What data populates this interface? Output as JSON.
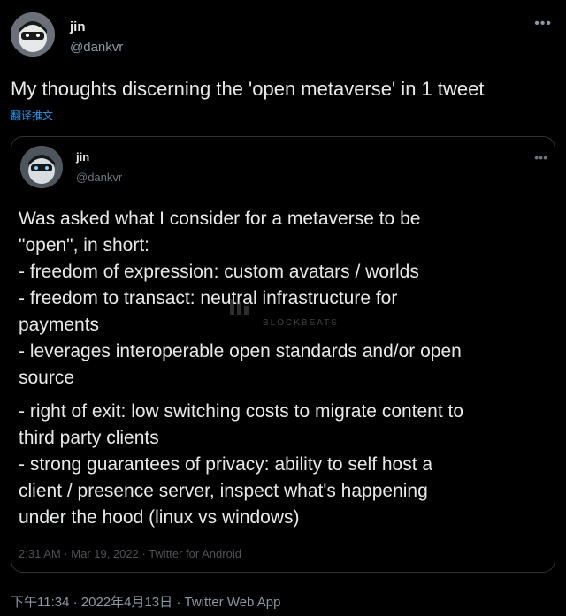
{
  "tweet": {
    "name": "jin",
    "handle": "@dankvr",
    "text": "My thoughts discerning the 'open metaverse' in 1 tweet",
    "translate_label": "翻译推文",
    "timestamp": "下午11:34 · 2022年4月13日 · Twitter Web App"
  },
  "quote": {
    "name": "jin",
    "handle": "@dankvr",
    "lines": [
      "Was asked what I consider for a metaverse to be",
      "\"open\", in short:",
      "- freedom of expression: custom avatars / worlds",
      "- freedom to transact: neutral infrastructure for",
      "payments",
      "- leverages interoperable open standards and/or open",
      "source",
      "- right of exit: low switching costs to migrate content to",
      "third party clients",
      "- strong guarantees of privacy: ability to self host a",
      "client / presence server, inspect what's happening",
      "under the hood (linux vs windows)"
    ],
    "timestamp": "2:31 AM · Mar 19, 2022 · Twitter for Android"
  },
  "watermark": {
    "text": "BLOCKBEATS"
  },
  "icons": {
    "more": "more-dots-icon",
    "avatar": "avatar-icon",
    "watermark": "blockbeats-logo-icon"
  },
  "colors": {
    "link": "#1d9bf0",
    "background": "#000000",
    "secondary": "#8b98a5"
  }
}
